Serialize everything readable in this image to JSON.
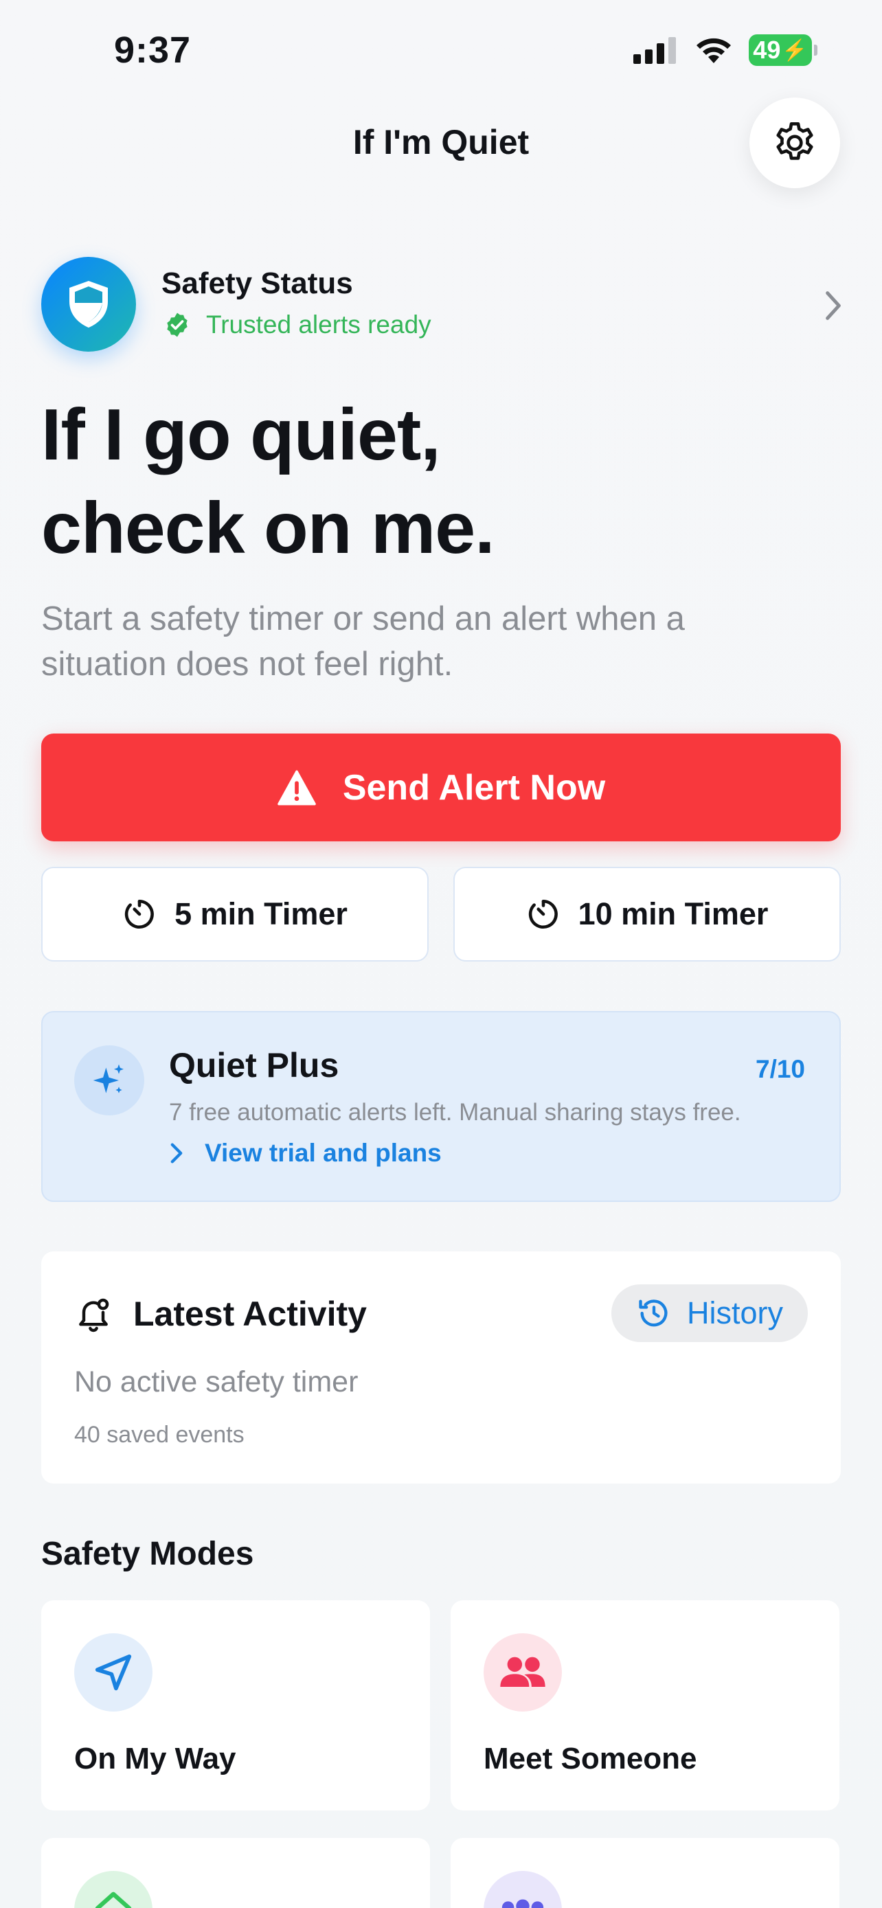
{
  "status_bar": {
    "time": "9:37",
    "battery": "49"
  },
  "nav": {
    "title": "If I'm Quiet",
    "settings_icon": "gear-icon"
  },
  "safety_status": {
    "title": "Safety Status",
    "subtitle": "Trusted alerts ready"
  },
  "hero": {
    "line1": "If I go quiet,",
    "line2": "check on me.",
    "subtitle": "Start a safety timer or send an alert when a situation does not feel right."
  },
  "actions": {
    "send_alert": "Send Alert Now",
    "timer_5": "5 min Timer",
    "timer_10": "10 min Timer"
  },
  "quiet_plus": {
    "title": "Quiet Plus",
    "count": "7/10",
    "description": "7 free automatic alerts left. Manual sharing stays free.",
    "link": "View trial and plans"
  },
  "latest_activity": {
    "title": "Latest Activity",
    "history_label": "History",
    "status": "No active safety timer",
    "saved": "40 saved events"
  },
  "safety_modes": {
    "title": "Safety Modes",
    "items": [
      {
        "label": "On My Way",
        "icon": "navigation-arrow-icon",
        "color": "#1a82e0"
      },
      {
        "label": "Meet Someone",
        "icon": "people-icon",
        "color": "#f0365a"
      },
      {
        "label": "",
        "icon": "home-icon",
        "color": "#34c759"
      },
      {
        "label": "",
        "icon": "group-icon",
        "color": "#5e5ce6"
      }
    ]
  },
  "colors": {
    "accent": "#1a82e0",
    "alert": "#f8383d",
    "success": "#34b558"
  }
}
